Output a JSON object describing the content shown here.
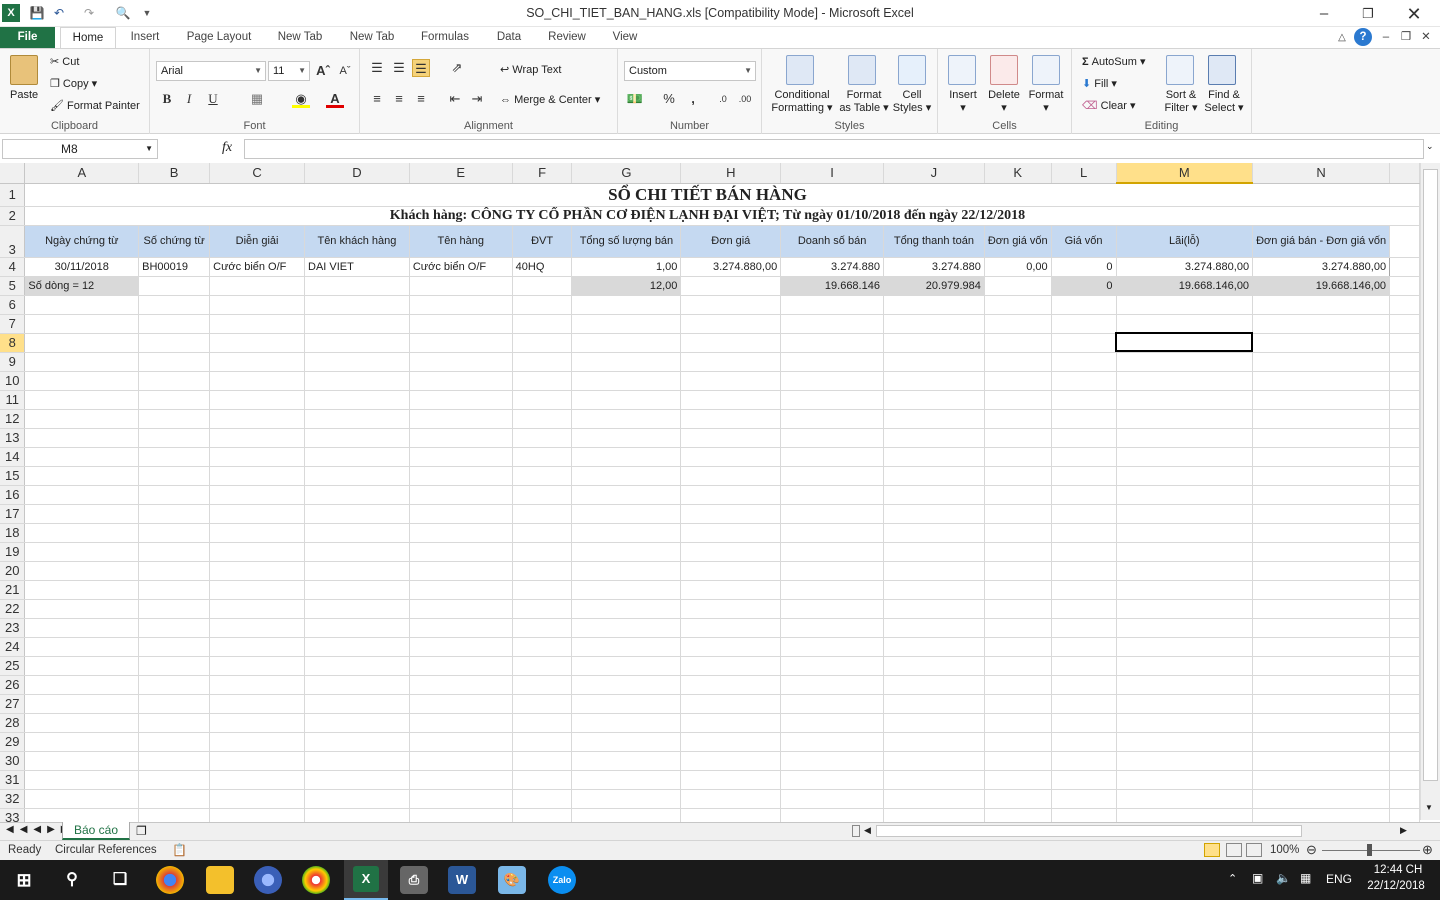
{
  "window": {
    "title": "SO_CHI_TIET_BAN_HANG.xls  [Compatibility Mode]  -  Microsoft Excel"
  },
  "tabs": [
    "File",
    "Home",
    "Insert",
    "Page Layout",
    "New Tab",
    "New Tab",
    "Formulas",
    "Data",
    "Review",
    "View"
  ],
  "ribbon": {
    "clipboard": {
      "label": "Clipboard",
      "paste": "Paste",
      "cut": "Cut",
      "copy": "Copy",
      "format_painter": "Format Painter"
    },
    "font": {
      "label": "Font",
      "name": "Arial",
      "size": "11",
      "bold": "B",
      "italic": "I",
      "underline": "U"
    },
    "alignment": {
      "label": "Alignment",
      "wrap": "Wrap Text",
      "merge": "Merge & Center"
    },
    "number": {
      "label": "Number",
      "format": "Custom",
      "percent": "%",
      "comma": ","
    },
    "styles": {
      "label": "Styles",
      "conditional": "Conditional",
      "conditional2": "Formatting",
      "format_table": "Format",
      "format_table2": "as Table",
      "cell_styles": "Cell",
      "cell_styles2": "Styles"
    },
    "cells": {
      "label": "Cells",
      "insert": "Insert",
      "delete": "Delete",
      "format": "Format"
    },
    "editing": {
      "label": "Editing",
      "autosum": "AutoSum",
      "fill": "Fill",
      "clear": "Clear",
      "sort": "Sort &",
      "sort2": "Filter",
      "find": "Find &",
      "find2": "Select"
    }
  },
  "formula_bar": {
    "name_box": "M8",
    "fx": "fx",
    "value": ""
  },
  "columns": [
    "A",
    "B",
    "C",
    "D",
    "E",
    "F",
    "G",
    "H",
    "I",
    "J",
    "K",
    "L",
    "M",
    "N"
  ],
  "selected_column": "M",
  "selected_row": "8",
  "sheet": {
    "title": "SỔ CHI TIẾT BÁN HÀNG",
    "subtitle": "Khách hàng: CÔNG TY CỔ PHẦN CƠ ĐIỆN LẠNH ĐẠI VIỆT; Từ ngày 01/10/2018 đến ngày 22/12/2018",
    "headers": [
      "Ngày chứng từ",
      "Số chứng từ",
      "Diễn giải",
      "Tên khách hàng",
      "Tên hàng",
      "ĐVT",
      "Tổng số lượng bán",
      "Đơn giá",
      "Doanh số bán",
      "Tổng thanh toán",
      "Đơn giá vốn",
      "Giá vốn",
      "Lãi(lỗ)",
      "Đơn giá bán - Đơn giá vốn"
    ],
    "row4": [
      "30/11/2018",
      "BH00019",
      "Cước biển O/F",
      "DAI VIET",
      "Cước biển O/F",
      "40HQ",
      "1,00",
      "3.274.880,00",
      "3.274.880",
      "3.274.880",
      "0,00",
      "0",
      "3.274.880,00",
      "3.274.880,00"
    ],
    "row5": [
      "Số dòng = 12",
      "",
      "",
      "",
      "",
      "",
      "12,00",
      "",
      "19.668.146",
      "20.979.984",
      "",
      "0",
      "19.668.146,00",
      "19.668.146,00"
    ]
  },
  "row_numbers": [
    "1",
    "2",
    "3",
    "4",
    "5",
    "6",
    "7",
    "8",
    "9",
    "10",
    "11",
    "12",
    "13",
    "14",
    "15",
    "16",
    "17",
    "18",
    "19",
    "20",
    "21",
    "22",
    "23",
    "24",
    "25",
    "26",
    "27",
    "28",
    "29",
    "30",
    "31",
    "32",
    "33"
  ],
  "sheet_tabs": [
    "Báo cáo"
  ],
  "status": {
    "ready": "Ready",
    "circular": "Circular References",
    "zoom": "100%"
  },
  "taskbar": {
    "lang": "ENG",
    "time": "12:44 CH",
    "date": "22/12/2018"
  }
}
